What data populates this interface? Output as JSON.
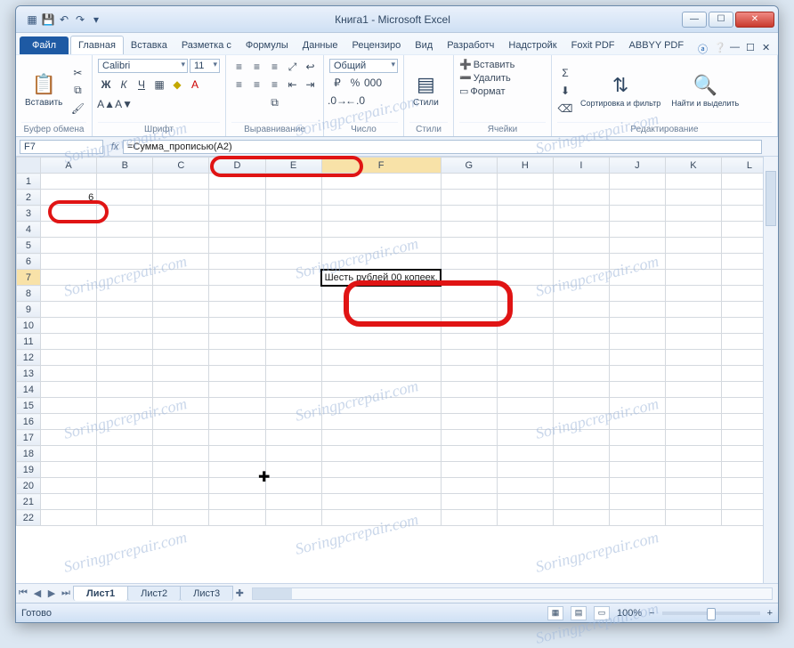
{
  "window": {
    "title": "Книга1 - Microsoft Excel",
    "qat_icons": [
      "excel-icon",
      "save-icon",
      "undo-icon",
      "redo-icon"
    ],
    "controls": {
      "min": "—",
      "max": "☐",
      "close": "✕"
    }
  },
  "ribbon": {
    "file": "Файл",
    "tabs": [
      "Главная",
      "Вставка",
      "Разметка с",
      "Формулы",
      "Данные",
      "Рецензиро",
      "Вид",
      "Разработч",
      "Надстройк",
      "Foxit PDF",
      "ABBYY PDF"
    ],
    "active_tab_index": 0,
    "groups": {
      "clipboard": {
        "title": "Буфер обмена",
        "paste": "Вставить"
      },
      "font": {
        "title": "Шрифт",
        "name": "Calibri",
        "size": "11"
      },
      "align": {
        "title": "Выравнивание"
      },
      "number": {
        "title": "Число",
        "format": "Общий"
      },
      "styles": {
        "title": "Стили",
        "btn": "Стили"
      },
      "cells": {
        "title": "Ячейки",
        "insert": "Вставить",
        "delete": "Удалить",
        "format": "Формат"
      },
      "editing": {
        "title": "Редактирование",
        "sort": "Сортировка и фильтр",
        "find": "Найти и выделить"
      }
    }
  },
  "formula_bar": {
    "name_box": "F7",
    "fx": "fx",
    "formula": "=Сумма_прописью(A2)"
  },
  "grid": {
    "columns": [
      "A",
      "B",
      "C",
      "D",
      "E",
      "F",
      "G",
      "H",
      "I",
      "J",
      "K",
      "L"
    ],
    "rows": 22,
    "active_col_index": 5,
    "active_row": 7,
    "cells": {
      "A2": "6",
      "F7": "Шесть рублей 00 копеек."
    }
  },
  "sheets": {
    "tabs": [
      "Лист1",
      "Лист2",
      "Лист3"
    ],
    "active": 0
  },
  "status": {
    "ready": "Готово",
    "zoom": "100%",
    "zoom_minus": "−",
    "zoom_plus": "+"
  },
  "watermark": "Soringpcrepair.com"
}
